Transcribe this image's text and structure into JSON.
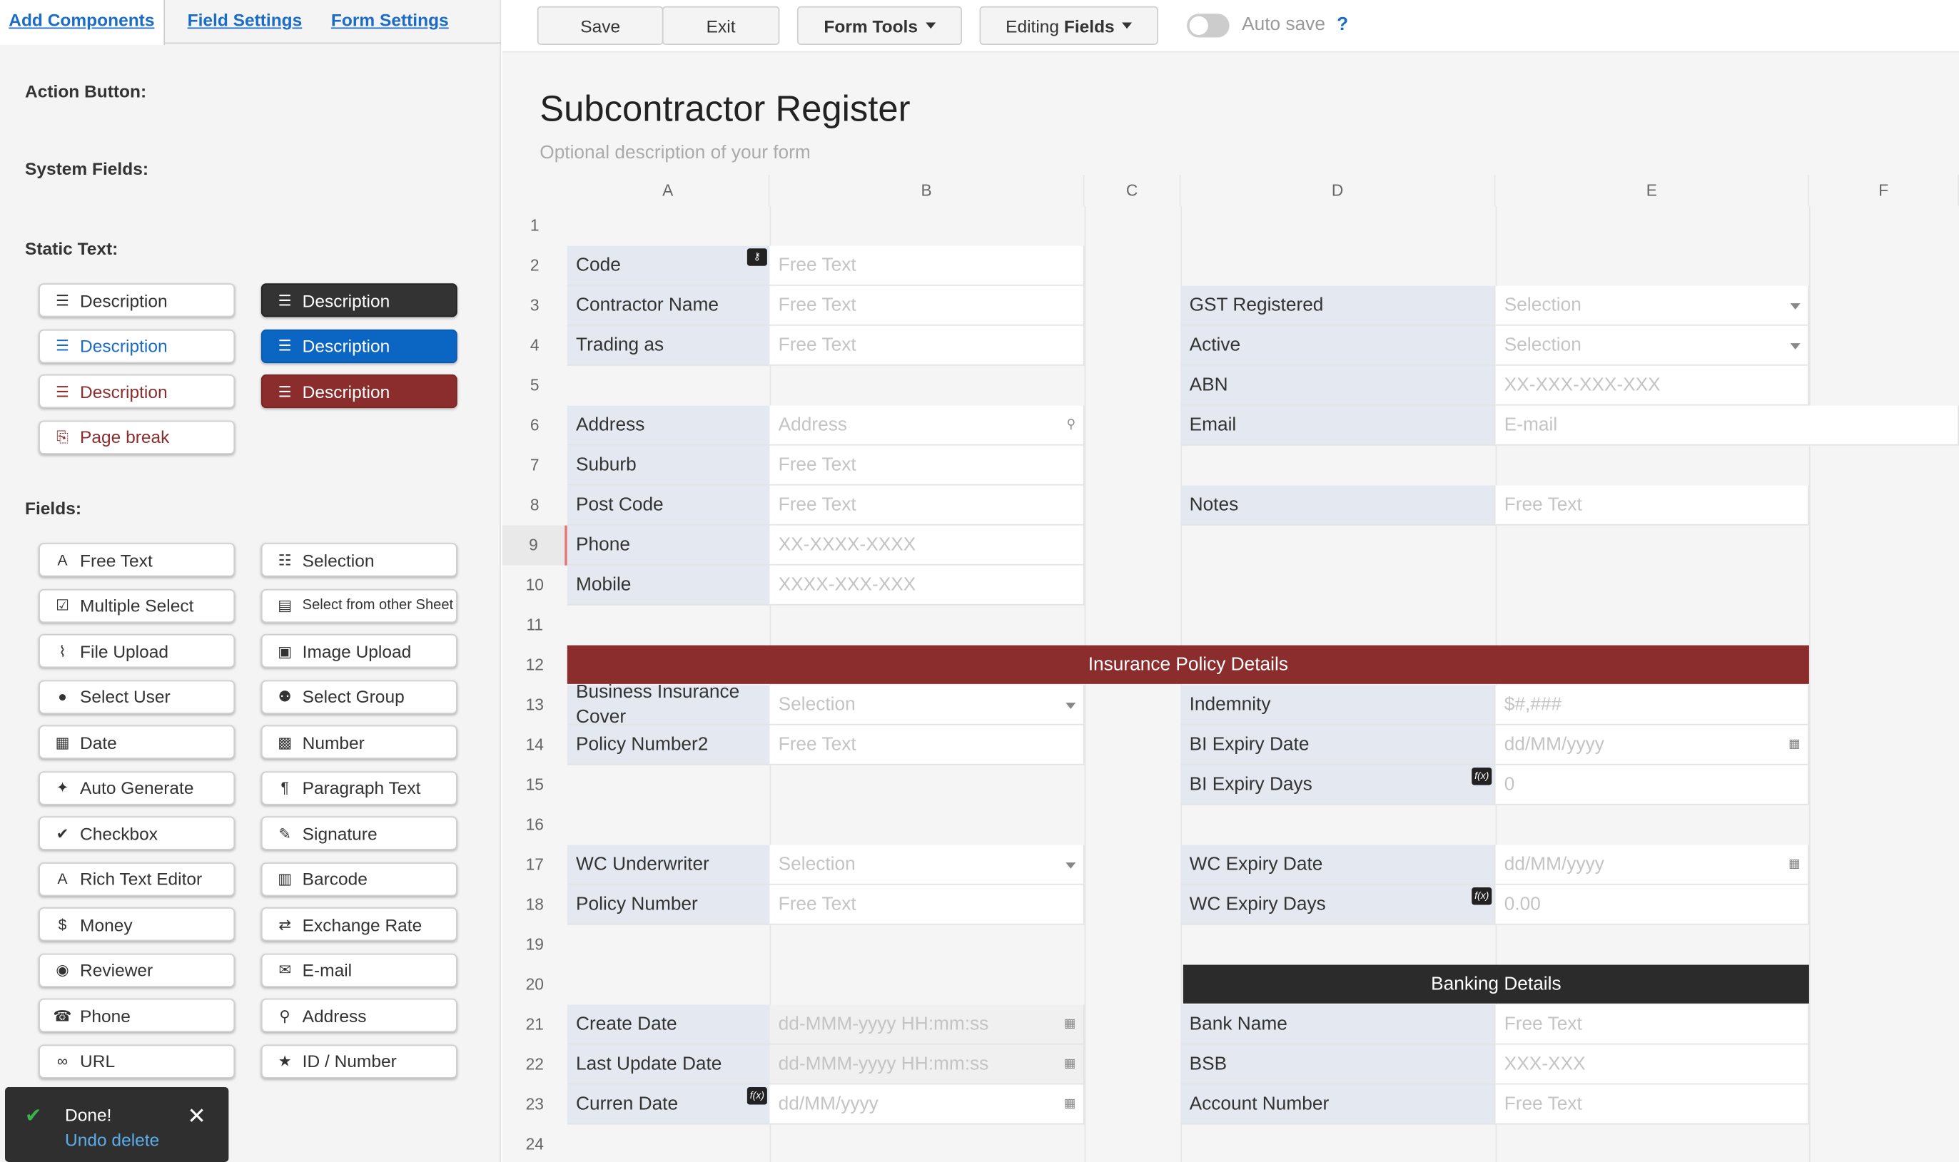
{
  "tabs": [
    {
      "label": "Add Components"
    },
    {
      "label": "Field Settings"
    },
    {
      "label": "Form Settings"
    }
  ],
  "left": {
    "sections": {
      "action": "Action Button:",
      "system": "System Fields:",
      "static": "Static Text:",
      "fields": "Fields:"
    },
    "static_items": [
      {
        "label": "Description",
        "style": "plain",
        "icon": "align-justify-icon"
      },
      {
        "label": "Description",
        "style": "dark",
        "icon": "align-justify-icon"
      },
      {
        "label": "Description",
        "style": "blue-t",
        "icon": "align-justify-icon"
      },
      {
        "label": "Description",
        "style": "blue",
        "icon": "align-justify-icon"
      },
      {
        "label": "Description",
        "style": "red-t",
        "icon": "align-justify-icon"
      },
      {
        "label": "Description",
        "style": "red",
        "icon": "align-justify-icon"
      },
      {
        "label": "Page break",
        "style": "red-t",
        "icon": "page-break-icon"
      }
    ],
    "field_items": [
      {
        "label": "Free Text",
        "icon": "font-icon"
      },
      {
        "label": "Selection",
        "icon": "list-icon"
      },
      {
        "label": "Multiple Select",
        "icon": "checkbox-icon"
      },
      {
        "label": "Select from other Sheet",
        "icon": "sheet-list-icon"
      },
      {
        "label": "File Upload",
        "icon": "paperclip-icon"
      },
      {
        "label": "Image Upload",
        "icon": "image-icon"
      },
      {
        "label": "Select User",
        "icon": "user-icon"
      },
      {
        "label": "Select Group",
        "icon": "users-icon"
      },
      {
        "label": "Date",
        "icon": "calendar-icon"
      },
      {
        "label": "Number",
        "icon": "calculator-icon"
      },
      {
        "label": "Auto Generate",
        "icon": "magic-icon"
      },
      {
        "label": "Paragraph Text",
        "icon": "paragraph-icon"
      },
      {
        "label": "Checkbox",
        "icon": "check-icon"
      },
      {
        "label": "Signature",
        "icon": "edit-icon"
      },
      {
        "label": "Rich Text Editor",
        "icon": "font-icon"
      },
      {
        "label": "Barcode",
        "icon": "barcode-icon"
      },
      {
        "label": "Money",
        "icon": "dollar-icon"
      },
      {
        "label": "Exchange Rate",
        "icon": "exchange-icon"
      },
      {
        "label": "Reviewer",
        "icon": "eye-icon"
      },
      {
        "label": "E-mail",
        "icon": "envelope-icon"
      },
      {
        "label": "Phone",
        "icon": "phone-icon"
      },
      {
        "label": "Address",
        "icon": "map-marker-icon"
      },
      {
        "label": "URL",
        "icon": "link-icon"
      },
      {
        "label": "ID / Number",
        "icon": "star-icon"
      }
    ]
  },
  "toast": {
    "title": "Done!",
    "link": "Undo delete"
  },
  "toolbar": {
    "save": "Save",
    "exit": "Exit",
    "form_tools": "Form Tools",
    "editing": "Editing",
    "fields": "Fields",
    "autosave": "Auto save",
    "help": "?"
  },
  "form": {
    "title": "Subcontractor Register",
    "description": "Optional description of your form"
  },
  "columns": [
    "A",
    "B",
    "C",
    "D",
    "E",
    "F"
  ],
  "rows": [
    "1",
    "2",
    "3",
    "4",
    "5",
    "6",
    "7",
    "8",
    "9",
    "10",
    "11",
    "12",
    "13",
    "14",
    "15",
    "16",
    "17",
    "18",
    "19",
    "20",
    "21",
    "22",
    "23",
    "24"
  ],
  "left_fields": [
    {
      "row": 2,
      "label": "Code",
      "placeholder": "Free Text",
      "badge": "key"
    },
    {
      "row": 3,
      "label": "Contractor Name",
      "placeholder": "Free Text"
    },
    {
      "row": 4,
      "label": "Trading as",
      "placeholder": "Free Text"
    },
    {
      "row": 6,
      "label": "Address",
      "placeholder": "Address",
      "suffix": "map-marker-icon"
    },
    {
      "row": 7,
      "label": "Suburb",
      "placeholder": "Free Text"
    },
    {
      "row": 8,
      "label": "Post Code",
      "placeholder": "Free Text"
    },
    {
      "row": 9,
      "label": "Phone",
      "placeholder": "XX-XXXX-XXXX"
    },
    {
      "row": 10,
      "label": "Mobile",
      "placeholder": "XXXX-XXX-XXX"
    },
    {
      "row": 13,
      "label": "Business Insurance Cover",
      "placeholder": "Selection",
      "suffix": "dropdown"
    },
    {
      "row": 14,
      "label": "Policy Number2",
      "placeholder": "Free Text"
    },
    {
      "row": 17,
      "label": "WC Underwriter",
      "placeholder": "Selection",
      "suffix": "dropdown"
    },
    {
      "row": 18,
      "label": "Policy Number",
      "placeholder": "Free Text"
    },
    {
      "row": 21,
      "label": "Create Date",
      "placeholder": "dd-MMM-yyyy HH:mm:ss",
      "suffix": "calendar-icon",
      "readonly": true
    },
    {
      "row": 22,
      "label": "Last Update Date",
      "placeholder": "dd-MMM-yyyy HH:mm:ss",
      "suffix": "calendar-icon",
      "readonly": true
    },
    {
      "row": 23,
      "label": "Curren Date",
      "placeholder": "dd/MM/yyyy",
      "suffix": "calendar-icon",
      "badge": "f(x)"
    }
  ],
  "right_fields": [
    {
      "row": 3,
      "label": "GST Registered",
      "placeholder": "Selection",
      "suffix": "dropdown"
    },
    {
      "row": 4,
      "label": "Active",
      "placeholder": "Selection",
      "suffix": "dropdown"
    },
    {
      "row": 5,
      "label": "ABN",
      "placeholder": "XX-XXX-XXX-XXX"
    },
    {
      "row": 6,
      "label": "Email",
      "placeholder": "E-mail",
      "wide": true
    },
    {
      "row": 8,
      "label": "Notes",
      "placeholder": "Free Text"
    },
    {
      "row": 13,
      "label": "Indemnity",
      "placeholder": "$#,###"
    },
    {
      "row": 14,
      "label": "BI Expiry Date",
      "placeholder": "dd/MM/yyyy",
      "suffix": "calendar-icon"
    },
    {
      "row": 15,
      "label": "BI Expiry Days",
      "placeholder": "0",
      "badge": "f(x)"
    },
    {
      "row": 17,
      "label": "WC Expiry Date",
      "placeholder": "dd/MM/yyyy",
      "suffix": "calendar-icon"
    },
    {
      "row": 18,
      "label": "WC Expiry Days",
      "placeholder": "0.00",
      "badge": "f(x)"
    },
    {
      "row": 21,
      "label": "Bank Name",
      "placeholder": "Free Text"
    },
    {
      "row": 22,
      "label": "BSB",
      "placeholder": "XXX-XXX"
    },
    {
      "row": 23,
      "label": "Account Number",
      "placeholder": "Free Text"
    }
  ],
  "banners": [
    {
      "row": 12,
      "label": "Insurance Policy Details",
      "style": "red"
    },
    {
      "row": 20,
      "label": "Banking Details",
      "style": "dark"
    }
  ],
  "colors": {
    "accent": "#1a6cc7",
    "label_bg": "#e4e9f1",
    "banner_red": "#8b2d2d",
    "banner_dark": "#2b2b2b"
  }
}
